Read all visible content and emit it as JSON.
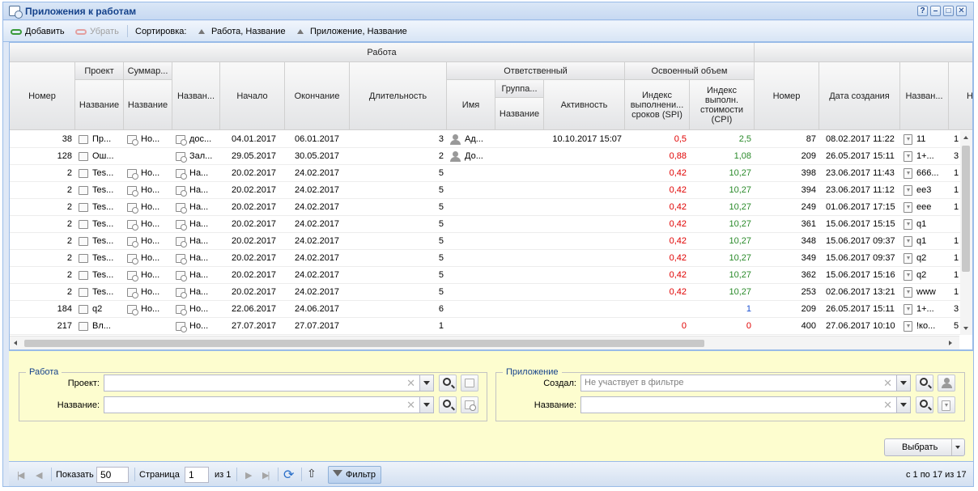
{
  "window": {
    "title": "Приложения к работам",
    "buttons": [
      "?",
      "–",
      "□",
      "✕"
    ]
  },
  "toolbar": {
    "add": "Добавить",
    "remove": "Убрать",
    "sort_label": "Сортировка:",
    "sort1": "Работа, Название",
    "sort2": "Приложение, Название"
  },
  "headers": {
    "work_group": "Работа",
    "number": "Номер",
    "project": "Проект",
    "summary": "Суммар...",
    "name_sub": "Название",
    "name": "Назван...",
    "start": "Начало",
    "end": "Окончание",
    "duration": "Длительность",
    "responsible": "Ответственный",
    "group": "Группа...",
    "person_name": "Имя",
    "activity": "Активность",
    "earned": "Освоенный объем",
    "spi": "Индекс выполнени... сроков (SPI)",
    "cpi": "Индекс выполн. стоимости (CPI)",
    "att_number": "Номер",
    "created": "Дата создания",
    "att_name": "Назван...",
    "cut": "Н"
  },
  "rows": [
    {
      "num": "38",
      "proj": "Пр...",
      "sum": "Но...",
      "name": "дос...",
      "start": "04.01.2017",
      "end": "06.01.2017",
      "dur": "3",
      "person": "Ад...",
      "act": "10.10.2017 15:07",
      "spi": "0,5",
      "cpi": "2,5",
      "cpi_color": "grn",
      "anum": "87",
      "created": "08.02.2017 11:22",
      "aname": "11",
      "last": "1"
    },
    {
      "num": "128",
      "proj": "Ош...",
      "sum": "",
      "name": "Зал...",
      "start": "29.05.2017",
      "end": "30.05.2017",
      "dur": "2",
      "person": "До...",
      "act": "",
      "spi": "0,88",
      "cpi": "1,08",
      "cpi_color": "grn",
      "anum": "209",
      "created": "26.05.2017 15:11",
      "aname": "1+...",
      "last": "3"
    },
    {
      "num": "2",
      "proj": "Tes...",
      "sum": "Но...",
      "name": "На...",
      "start": "20.02.2017",
      "end": "24.02.2017",
      "dur": "5",
      "person": "",
      "act": "",
      "spi": "0,42",
      "cpi": "10,27",
      "cpi_color": "grn",
      "anum": "398",
      "created": "23.06.2017 11:43",
      "aname": "666...",
      "last": "1"
    },
    {
      "num": "2",
      "proj": "Tes...",
      "sum": "Но...",
      "name": "На...",
      "start": "20.02.2017",
      "end": "24.02.2017",
      "dur": "5",
      "person": "",
      "act": "",
      "spi": "0,42",
      "cpi": "10,27",
      "cpi_color": "grn",
      "anum": "394",
      "created": "23.06.2017 11:12",
      "aname": "ee3",
      "last": "1"
    },
    {
      "num": "2",
      "proj": "Tes...",
      "sum": "Но...",
      "name": "На...",
      "start": "20.02.2017",
      "end": "24.02.2017",
      "dur": "5",
      "person": "",
      "act": "",
      "spi": "0,42",
      "cpi": "10,27",
      "cpi_color": "grn",
      "anum": "249",
      "created": "01.06.2017 17:15",
      "aname": "eee",
      "last": "1"
    },
    {
      "num": "2",
      "proj": "Tes...",
      "sum": "Но...",
      "name": "На...",
      "start": "20.02.2017",
      "end": "24.02.2017",
      "dur": "5",
      "person": "",
      "act": "",
      "spi": "0,42",
      "cpi": "10,27",
      "cpi_color": "grn",
      "anum": "361",
      "created": "15.06.2017 15:15",
      "aname": "q1",
      "last": ""
    },
    {
      "num": "2",
      "proj": "Tes...",
      "sum": "Но...",
      "name": "На...",
      "start": "20.02.2017",
      "end": "24.02.2017",
      "dur": "5",
      "person": "",
      "act": "",
      "spi": "0,42",
      "cpi": "10,27",
      "cpi_color": "grn",
      "anum": "348",
      "created": "15.06.2017 09:37",
      "aname": "q1",
      "last": "1"
    },
    {
      "num": "2",
      "proj": "Tes...",
      "sum": "Но...",
      "name": "На...",
      "start": "20.02.2017",
      "end": "24.02.2017",
      "dur": "5",
      "person": "",
      "act": "",
      "spi": "0,42",
      "cpi": "10,27",
      "cpi_color": "grn",
      "anum": "349",
      "created": "15.06.2017 09:37",
      "aname": "q2",
      "last": "1"
    },
    {
      "num": "2",
      "proj": "Tes...",
      "sum": "Но...",
      "name": "На...",
      "start": "20.02.2017",
      "end": "24.02.2017",
      "dur": "5",
      "person": "",
      "act": "",
      "spi": "0,42",
      "cpi": "10,27",
      "cpi_color": "grn",
      "anum": "362",
      "created": "15.06.2017 15:16",
      "aname": "q2",
      "last": "1"
    },
    {
      "num": "2",
      "proj": "Tes...",
      "sum": "Но...",
      "name": "На...",
      "start": "20.02.2017",
      "end": "24.02.2017",
      "dur": "5",
      "person": "",
      "act": "",
      "spi": "0,42",
      "cpi": "10,27",
      "cpi_color": "grn",
      "anum": "253",
      "created": "02.06.2017 13:21",
      "aname": "www",
      "last": "1"
    },
    {
      "num": "184",
      "proj": "q2",
      "sum": "Но...",
      "name": "Но...",
      "start": "22.06.2017",
      "end": "24.06.2017",
      "dur": "6",
      "person": "",
      "act": "",
      "spi": "",
      "cpi": "1",
      "cpi_color": "blu",
      "anum": "209",
      "created": "26.05.2017 15:11",
      "aname": "1+...",
      "last": "3"
    },
    {
      "num": "217",
      "proj": "Вл...",
      "sum": "",
      "name": "Но...",
      "start": "27.07.2017",
      "end": "27.07.2017",
      "dur": "1",
      "person": "",
      "act": "",
      "spi": "0",
      "cpi": "0",
      "cpi_color": "red",
      "anum": "400",
      "created": "27.06.2017 10:10",
      "aname": "!ко...",
      "last": "5"
    }
  ],
  "filter": {
    "work_legend": "Работа",
    "project_label": "Проект:",
    "name_label": "Название:",
    "app_legend": "Приложение",
    "created_label": "Создал:",
    "created_placeholder": "Не участвует в фильтре",
    "app_name_label": "Название:",
    "select_button": "Выбрать"
  },
  "pager": {
    "show_label": "Показать",
    "page_size": "50",
    "page_label": "Страница",
    "page": "1",
    "of": "из 1",
    "filter_button": "Фильтр",
    "summary": "с 1 по 17 из 17"
  }
}
